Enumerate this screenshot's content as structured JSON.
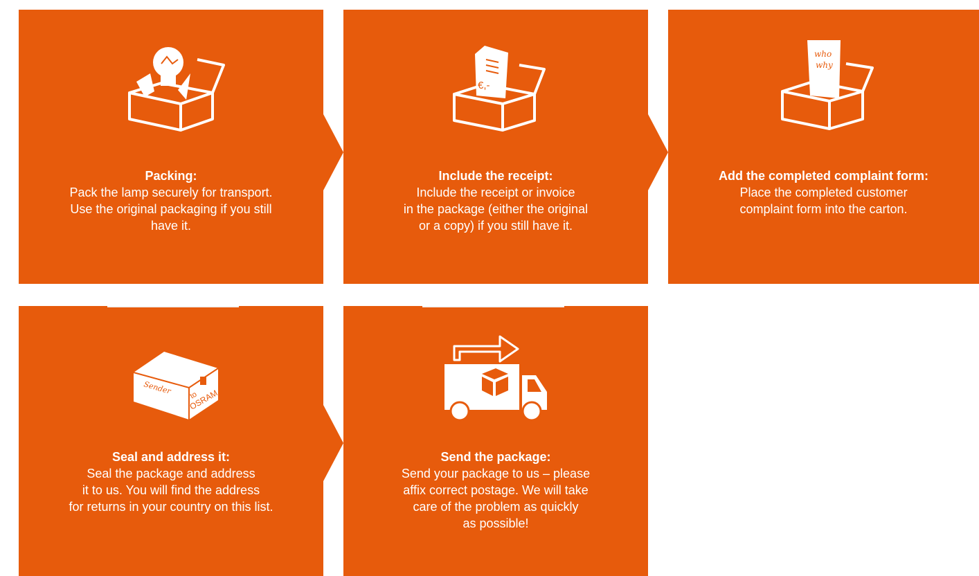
{
  "colors": {
    "tile": "#e75b0c",
    "background": "#ffffff",
    "icon_stroke": "#ffffff"
  },
  "steps": [
    {
      "title": "Packing:",
      "body": "Pack the lamp securely for transport.\nUse the original packaging if you still\nhave it.",
      "icon": "box-with-lamp-icon"
    },
    {
      "title": "Include the receipt:",
      "body": "Include the receipt or invoice\nin the package (either the original\nor a copy) if you still have it.",
      "icon": "box-with-receipt-icon",
      "icon_text": "€,-"
    },
    {
      "title": "Add the completed complaint form:",
      "body": "Place the completed customer\ncomplaint form into the carton.",
      "icon": "box-with-form-icon",
      "icon_text": [
        "who",
        "why"
      ]
    },
    {
      "title": "Seal and address it:",
      "body": "Seal the package and address\nit to us. You will find the address\nfor returns in your country on this list.",
      "icon": "sealed-box-icon",
      "icon_text": [
        "Sender",
        "to",
        "OSRAM"
      ]
    },
    {
      "title": "Send the package:",
      "body": "Send your package to us – please\naffix correct postage. We will take\ncare of the problem as quickly\nas possible!",
      "icon": "delivery-truck-icon"
    }
  ]
}
